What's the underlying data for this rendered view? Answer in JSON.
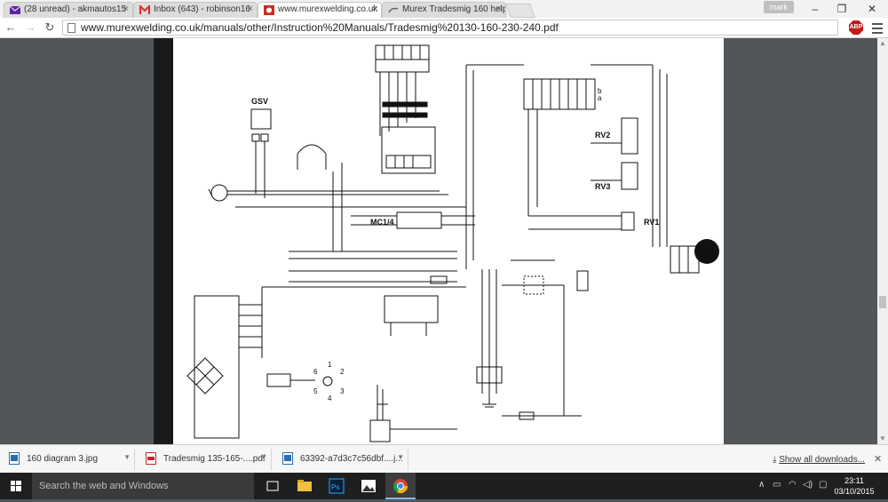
{
  "browser": {
    "tabs": [
      {
        "label": "(28 unread) - akmautos15"
      },
      {
        "label": "Inbox (643) - robinson16"
      },
      {
        "label": "www.murexwelding.co.uk"
      },
      {
        "label": "Murex Tradesmig 160 help"
      }
    ],
    "profile_name": "mark",
    "address": "www.murexwelding.co.uk/manuals/other/Instruction%20Manuals/Tradesmig%20130-160-230-240.pdf",
    "abp_label": "ABP"
  },
  "diagram": {
    "labels": {
      "gsv": "GSV",
      "rv2": "RV2",
      "rv3": "RV3",
      "rv1": "RV1",
      "mc": "MC1/4",
      "a": "a",
      "b": "b",
      "n1": "1",
      "n2": "2",
      "n3": "3",
      "n4": "4",
      "n5": "5",
      "n6": "6"
    }
  },
  "downloads": {
    "items": [
      {
        "name": "160 diagram 3.jpg"
      },
      {
        "name": "Tradesmig 135-165-....pdf"
      },
      {
        "name": "63392-a7d3c7c56dbf....j..."
      }
    ],
    "show_all": "Show all downloads..."
  },
  "taskbar": {
    "search_placeholder": "Search the web and Windows",
    "time": "23:11",
    "date": "03/10/2015"
  },
  "colors": {
    "yahoo": "#5f259f",
    "gmail": "#d93025",
    "chrome_red": "#db4437",
    "abp": "#c21b1b",
    "taskbar": "#1f1f1f"
  }
}
